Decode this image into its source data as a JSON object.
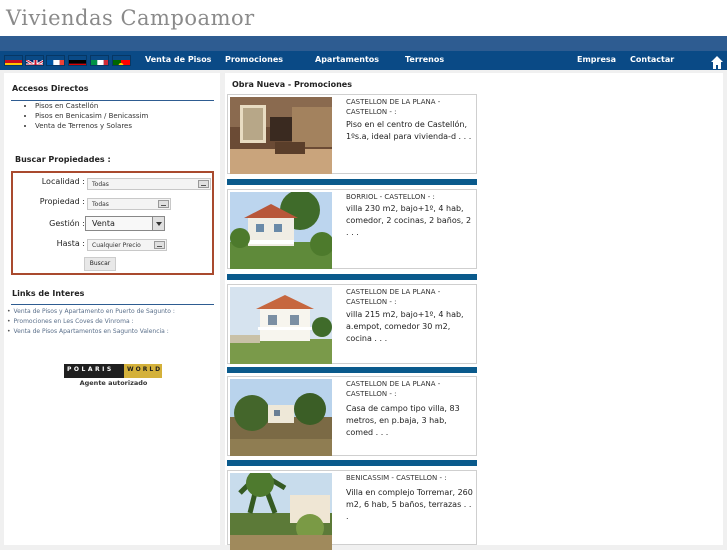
{
  "header": {
    "logo_text": "Viviendas Campoamor"
  },
  "nav": {
    "flags": [
      {
        "name": "flag-spain",
        "colors": [
          "#c60b1e",
          "#ffc400",
          "#c60b1e"
        ]
      },
      {
        "name": "flag-uk",
        "colors": [
          "#012169",
          "#ffffff",
          "#c8102e"
        ]
      },
      {
        "name": "flag-france",
        "colors": [
          "#0055a4",
          "#ffffff",
          "#ef4135"
        ]
      },
      {
        "name": "flag-germany",
        "colors": [
          "#000000",
          "#dd0000",
          "#ffce00"
        ]
      },
      {
        "name": "flag-italy",
        "colors": [
          "#009246",
          "#ffffff",
          "#ce2b37"
        ]
      },
      {
        "name": "flag-portugal",
        "colors": [
          "#006600",
          "#ff0000",
          "#ffcc00"
        ]
      }
    ],
    "links": [
      "Venta de Pisos",
      "Promociones",
      "Apartamentos",
      "Terrenos"
    ],
    "right_links": [
      "Empresa",
      "Contactar"
    ],
    "home_icon": "home-icon"
  },
  "sidebar": {
    "accesos_title": "Accesos Directos",
    "accesos_items": [
      "Pisos en Castellón",
      "Pisos en Benicasim / Benicassim",
      "Venta de Terrenos y Solares"
    ],
    "buscar_title": "Buscar Propiedades :",
    "form": {
      "localidad_label": "Localidad :",
      "localidad_value": "Todas",
      "propiedad_label": "Propiedad :",
      "propiedad_value": "Todas",
      "gestion_label": "Gestión :",
      "gestion_value": "Venta",
      "hasta_label": "Hasta :",
      "hasta_value": "Cualquier Precio",
      "buscar_button": "Buscar"
    },
    "links_title": "Links de Interes",
    "links": [
      "Venta de Pisos y Apartamento en Puerto de Sagunto :",
      "Promociones en Les Coves de Vinroma :",
      "Venta de Pisos Apartamentos en Sagunto Valencia :"
    ],
    "polaris": {
      "left": "POLARIS",
      "right": "WORLD",
      "caption": "Agente autorizado"
    }
  },
  "main": {
    "title": "Obra Nueva - Promociones",
    "listings": [
      {
        "location": "CASTELLON DE LA PLANA - CASTELLON - :",
        "description": "Piso en el centro de Castellón, 1ºs.a, ideal para vivienda-d . . ."
      },
      {
        "location": "BORRIOL - CASTELLON - :",
        "description": "villa 230 m2, bajo+1º, 4 hab, comedor, 2 cocinas, 2 baños, 2 . . ."
      },
      {
        "location": "CASTELLON DE LA PLANA - CASTELLON - :",
        "description": "villa 215 m2, bajo+1º, 4 hab, a.empot, comedor 30 m2, cocina . . ."
      },
      {
        "location": "CASTELLON DE LA PLANA - CASTELLON - :",
        "description": "Casa de campo tipo villa, 83 metros, en p.baja, 3 hab, comed . . ."
      },
      {
        "location": "BENICASSIM - CASTELLON - :",
        "description": "Villa en complejo Torremar, 260 m2, 6 hab, 5 baños, terrazas . . ."
      }
    ]
  },
  "colors": {
    "nav_bg": "#0a4a86",
    "blue_bar": "#2e5c91",
    "search_border": "#a94a2e",
    "divider": "#0a5a8c"
  }
}
